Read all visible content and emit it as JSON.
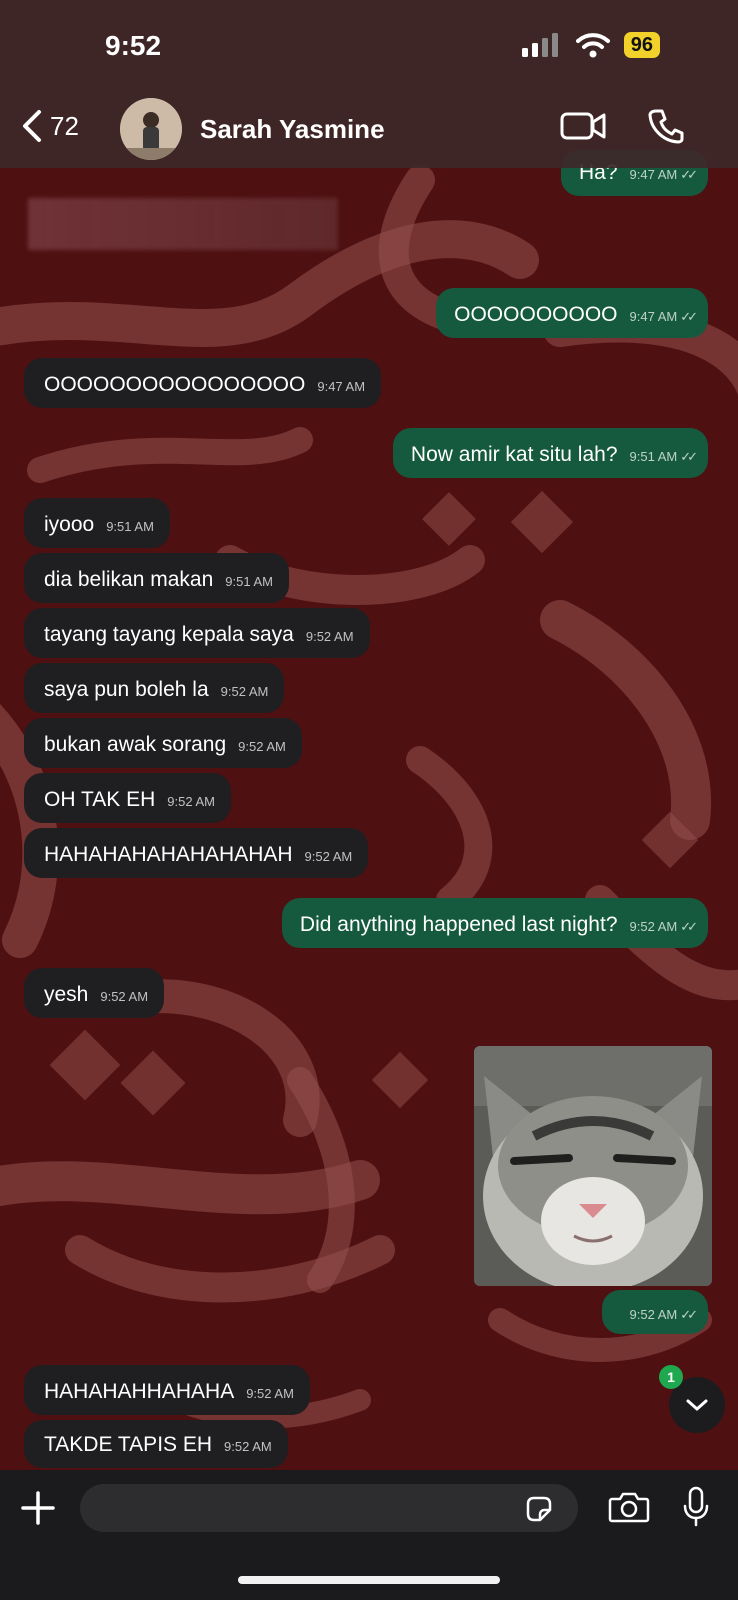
{
  "status_bar": {
    "time": "9:52",
    "battery": "96"
  },
  "header": {
    "back_count": "72",
    "contact_name": "Sarah Yasmine"
  },
  "messages": [
    {
      "dir": "out",
      "text": "Ha?",
      "time": "9:47 AM"
    },
    {
      "dir": "out",
      "text": "OOOOOOOOOO",
      "time": "9:47 AM"
    },
    {
      "dir": "in",
      "text": "OOOOOOOOOOOOOOOO",
      "time": "9:47 AM"
    },
    {
      "dir": "out",
      "text": "Now amir kat situ lah?",
      "time": "9:51 AM"
    },
    {
      "dir": "in",
      "text": "iyooo",
      "time": "9:51 AM"
    },
    {
      "dir": "in",
      "text": "dia belikan makan",
      "time": "9:51 AM"
    },
    {
      "dir": "in",
      "text": "tayang tayang kepala saya",
      "time": "9:52 AM"
    },
    {
      "dir": "in",
      "text": "saya pun boleh la",
      "time": "9:52 AM"
    },
    {
      "dir": "in",
      "text": "bukan awak sorang",
      "time": "9:52 AM"
    },
    {
      "dir": "in",
      "text": "OH TAK EH",
      "time": "9:52 AM"
    },
    {
      "dir": "in",
      "text": "HAHAHAHAHAHAHAHAH",
      "time": "9:52 AM"
    },
    {
      "dir": "out",
      "text": "Did anything happened last night?",
      "time": "9:52 AM"
    },
    {
      "dir": "in",
      "text": "yesh",
      "time": "9:52 AM"
    },
    {
      "dir": "out",
      "text": "",
      "time": "9:52 AM"
    },
    {
      "dir": "in",
      "text": "HAHAHAHHAHAHA",
      "time": "9:52 AM"
    },
    {
      "dir": "in",
      "text": "TAKDE TAPIS EH",
      "time": "9:52 AM"
    }
  ],
  "scroll_button": {
    "unread_count": "1"
  },
  "composer": {
    "placeholder": ""
  },
  "colors": {
    "incoming_bubble": "#1f1f22",
    "outgoing_bubble": "#155a3f",
    "wallpaper": "#4a0f10"
  }
}
